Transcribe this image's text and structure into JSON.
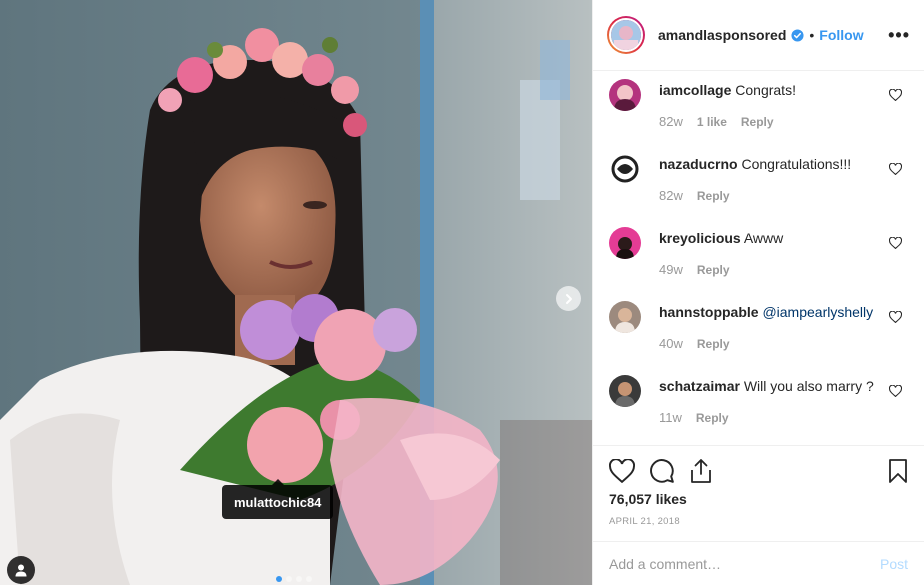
{
  "photo": {
    "tag_username": "mulattochic84",
    "carousel_dots": 4,
    "active_dot": 0
  },
  "header": {
    "username": "amandlasponsored",
    "verified": true,
    "bullet": "•",
    "follow_label": "Follow"
  },
  "comments": [
    {
      "user": "iamcollage",
      "text": "Congrats!",
      "mention": "",
      "age": "82w",
      "likes": "1 like",
      "reply": "Reply",
      "avatar_color": "#b4337e"
    },
    {
      "user": "nazaducrno",
      "text": "Congratulations!!!",
      "mention": "",
      "age": "82w",
      "likes": "",
      "reply": "Reply",
      "avatar_color": "#ffffff"
    },
    {
      "user": "kreyolicious",
      "text": "Awww",
      "mention": "",
      "age": "49w",
      "likes": "",
      "reply": "Reply",
      "avatar_color": "#e43c95"
    },
    {
      "user": "hannstoppable",
      "text": "",
      "mention": "@iampearlyshelly",
      "age": "40w",
      "likes": "",
      "reply": "Reply",
      "avatar_color": "#9c8a7e"
    },
    {
      "user": "schatzaimar",
      "text": "Will you also marry ?",
      "mention": "",
      "age": "11w",
      "likes": "",
      "reply": "Reply",
      "avatar_color": "#3a3a3a"
    }
  ],
  "likes": "76,057 likes",
  "date": "APRIL 21, 2018",
  "add_comment": {
    "placeholder": "Add a comment…",
    "post_label": "Post"
  },
  "colors": {
    "accent": "#3897f0",
    "muted": "#999999",
    "border": "#efefef"
  }
}
